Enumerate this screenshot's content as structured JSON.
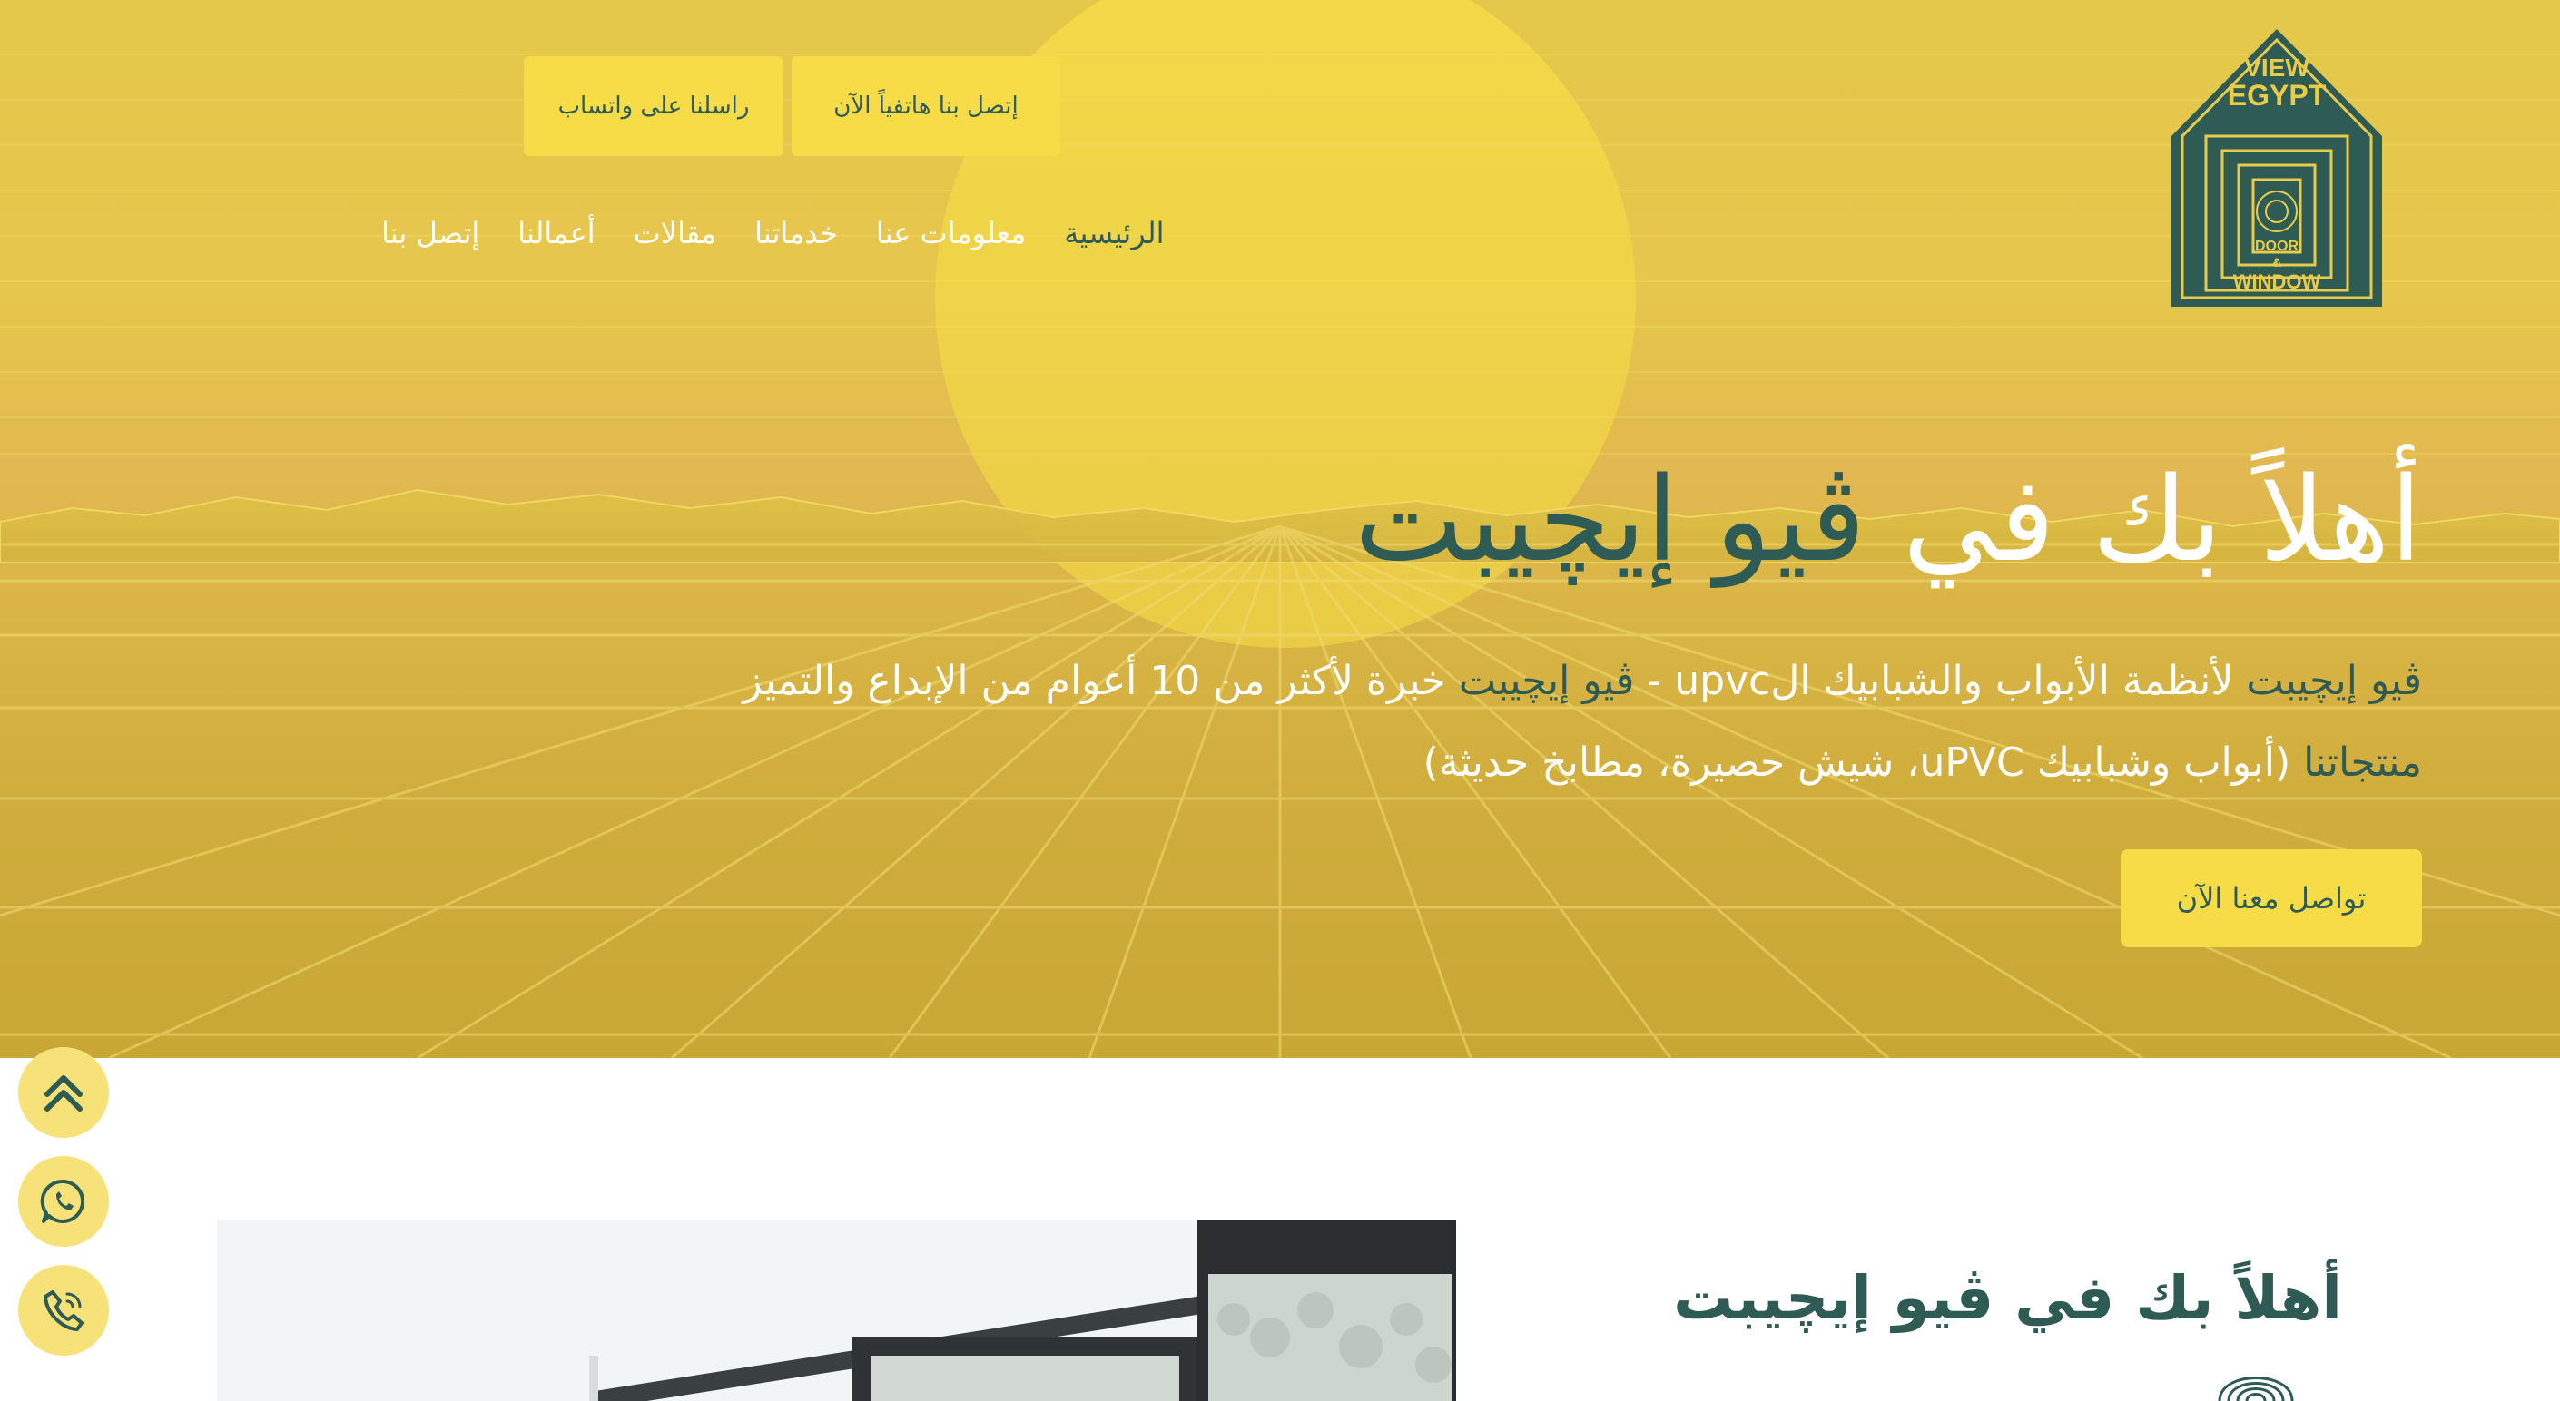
{
  "logo": {
    "line1": "VIEW",
    "line2": "EGYPT",
    "line3": "DOOR",
    "line4": "&",
    "line5": "WINDOW"
  },
  "header": {
    "call_button": "إتصل بنا هاتفياً الآن",
    "whatsapp_button": "راسلنا على واتساب"
  },
  "nav": {
    "items": [
      {
        "label": "الرئيسية",
        "active": true
      },
      {
        "label": "معلومات عنا",
        "active": false
      },
      {
        "label": "خدماتنا",
        "active": false
      },
      {
        "label": "مقالات",
        "active": false
      },
      {
        "label": "أعمالنا",
        "active": false
      },
      {
        "label": "إتصل بنا",
        "active": false
      }
    ]
  },
  "hero": {
    "title_prefix": "أهلاً بك في",
    "title_brand": "ڤيو إيچيبت",
    "line1_a": "ڤيو إيچيبت",
    "line1_b": "لأنظمة الأبواب والشبابيك الupvc -",
    "line1_c": "ڤيو إيچيبت",
    "line1_d": "خبرة لأكثر من 10 أعوام من الإبداع والتميز",
    "line2_a": "منتجاتنا",
    "line2_b": "(أبواب وشبابيك uPVC، شيش حصيرة، مطابخ حديثة)",
    "cta": "تواصل معنا الآن"
  },
  "floating": {
    "scroll_top_icon": "double-chevron-up-icon",
    "whatsapp_icon": "whatsapp-icon",
    "phone_icon": "phone-icon"
  },
  "about": {
    "title": "أهلاً بك في ڤيو إيچيبت"
  },
  "colors": {
    "brand_teal": "#2f5b55",
    "button_yellow": "#f7dc48",
    "float_yellow": "#f7e27a",
    "hero_yellow": "#e4c84a"
  }
}
